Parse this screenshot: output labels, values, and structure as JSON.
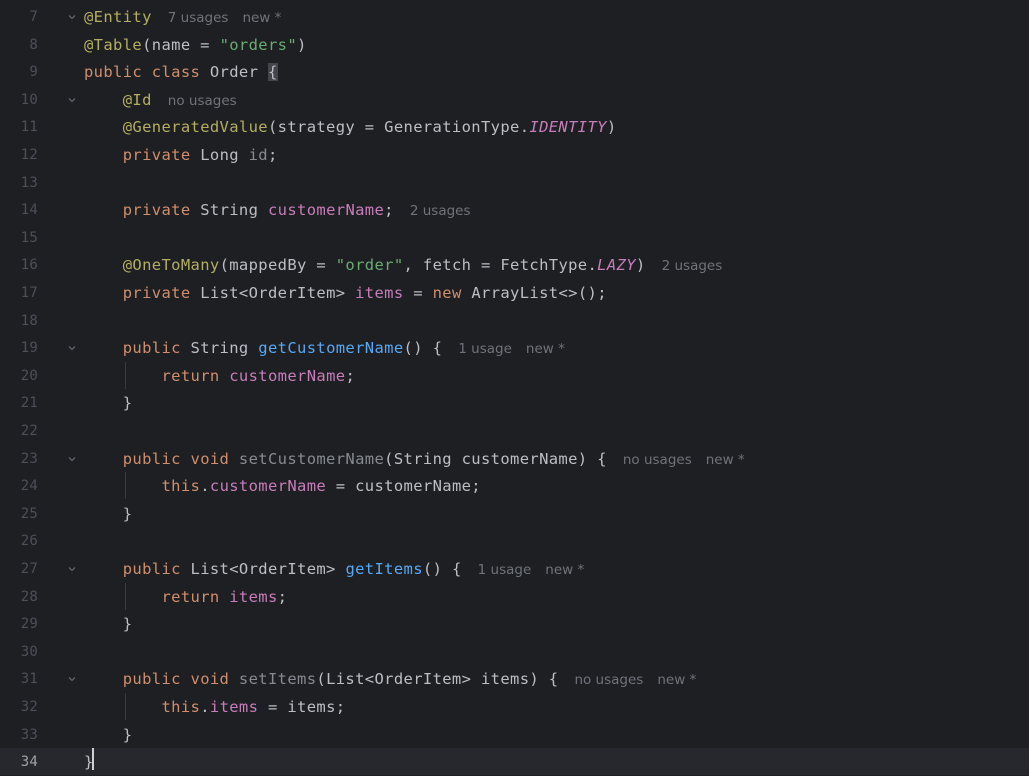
{
  "editor": {
    "language": "Java",
    "current_line": 34,
    "lines": [
      {
        "num": "7",
        "fold": true,
        "tokens": [
          [
            "ann",
            "@Entity"
          ]
        ],
        "hints": [
          "7 usages",
          "new *"
        ]
      },
      {
        "num": "8",
        "tokens": [
          [
            "ann",
            "@Table"
          ],
          [
            "plain",
            "(name = "
          ],
          [
            "str",
            "\"orders\""
          ],
          [
            "plain",
            ")"
          ]
        ]
      },
      {
        "num": "9",
        "tokens": [
          [
            "kw",
            "public class "
          ],
          [
            "plain",
            "Order "
          ],
          [
            "brace-hl",
            "{"
          ]
        ]
      },
      {
        "num": "10",
        "fold": true,
        "tokens": [
          [
            "plain",
            "    "
          ],
          [
            "ann",
            "@Id"
          ]
        ],
        "hints": [
          "no usages"
        ]
      },
      {
        "num": "11",
        "tokens": [
          [
            "plain",
            "    "
          ],
          [
            "ann",
            "@GeneratedValue"
          ],
          [
            "plain",
            "(strategy = GenerationType."
          ],
          [
            "static",
            "IDENTITY"
          ],
          [
            "plain",
            ")"
          ]
        ]
      },
      {
        "num": "12",
        "tokens": [
          [
            "plain",
            "    "
          ],
          [
            "kw",
            "private "
          ],
          [
            "plain",
            "Long "
          ],
          [
            "unused",
            "id"
          ],
          [
            "plain",
            ";"
          ]
        ]
      },
      {
        "num": "13",
        "tokens": []
      },
      {
        "num": "14",
        "tokens": [
          [
            "plain",
            "    "
          ],
          [
            "kw",
            "private "
          ],
          [
            "plain",
            "String "
          ],
          [
            "field",
            "customerName"
          ],
          [
            "plain",
            ";"
          ]
        ],
        "hints": [
          "2 usages"
        ]
      },
      {
        "num": "15",
        "tokens": []
      },
      {
        "num": "16",
        "tokens": [
          [
            "plain",
            "    "
          ],
          [
            "ann",
            "@OneToMany"
          ],
          [
            "plain",
            "(mappedBy = "
          ],
          [
            "str",
            "\"order\""
          ],
          [
            "plain",
            ", fetch = FetchType."
          ],
          [
            "static",
            "LAZY"
          ],
          [
            "plain",
            ")"
          ]
        ],
        "hints": [
          "2 usages"
        ]
      },
      {
        "num": "17",
        "tokens": [
          [
            "plain",
            "    "
          ],
          [
            "kw",
            "private "
          ],
          [
            "plain",
            "List<OrderItem> "
          ],
          [
            "field",
            "items"
          ],
          [
            "plain",
            " = "
          ],
          [
            "kw",
            "new "
          ],
          [
            "plain",
            "ArrayList<>();"
          ]
        ]
      },
      {
        "num": "18",
        "tokens": []
      },
      {
        "num": "19",
        "fold": true,
        "tokens": [
          [
            "plain",
            "    "
          ],
          [
            "kw",
            "public "
          ],
          [
            "plain",
            "String "
          ],
          [
            "fn",
            "getCustomerName"
          ],
          [
            "plain",
            "() {"
          ]
        ],
        "hints": [
          "1 usage",
          "new *"
        ]
      },
      {
        "num": "20",
        "guide": true,
        "tokens": [
          [
            "plain",
            "        "
          ],
          [
            "kw",
            "return "
          ],
          [
            "field",
            "customerName"
          ],
          [
            "plain",
            ";"
          ]
        ]
      },
      {
        "num": "21",
        "tokens": [
          [
            "plain",
            "    }"
          ]
        ]
      },
      {
        "num": "22",
        "tokens": []
      },
      {
        "num": "23",
        "fold": true,
        "tokens": [
          [
            "plain",
            "    "
          ],
          [
            "kw",
            "public void "
          ],
          [
            "unused",
            "setCustomerName"
          ],
          [
            "plain",
            "(String customerName) {"
          ]
        ],
        "hints": [
          "no usages",
          "new *"
        ]
      },
      {
        "num": "24",
        "guide": true,
        "tokens": [
          [
            "plain",
            "        "
          ],
          [
            "kw",
            "this"
          ],
          [
            "plain",
            "."
          ],
          [
            "field",
            "customerName"
          ],
          [
            "plain",
            " = customerName;"
          ]
        ]
      },
      {
        "num": "25",
        "tokens": [
          [
            "plain",
            "    }"
          ]
        ]
      },
      {
        "num": "26",
        "tokens": []
      },
      {
        "num": "27",
        "fold": true,
        "tokens": [
          [
            "plain",
            "    "
          ],
          [
            "kw",
            "public "
          ],
          [
            "plain",
            "List<OrderItem> "
          ],
          [
            "fn",
            "getItems"
          ],
          [
            "plain",
            "() {"
          ]
        ],
        "hints": [
          "1 usage",
          "new *"
        ]
      },
      {
        "num": "28",
        "guide": true,
        "tokens": [
          [
            "plain",
            "        "
          ],
          [
            "kw",
            "return "
          ],
          [
            "field",
            "items"
          ],
          [
            "plain",
            ";"
          ]
        ]
      },
      {
        "num": "29",
        "tokens": [
          [
            "plain",
            "    }"
          ]
        ]
      },
      {
        "num": "30",
        "tokens": []
      },
      {
        "num": "31",
        "fold": true,
        "tokens": [
          [
            "plain",
            "    "
          ],
          [
            "kw",
            "public void "
          ],
          [
            "unused",
            "setItems"
          ],
          [
            "plain",
            "(List<OrderItem> items) {"
          ]
        ],
        "hints": [
          "no usages",
          "new *"
        ]
      },
      {
        "num": "32",
        "guide": true,
        "tokens": [
          [
            "plain",
            "        "
          ],
          [
            "kw",
            "this"
          ],
          [
            "plain",
            "."
          ],
          [
            "field",
            "items"
          ],
          [
            "plain",
            " = items;"
          ]
        ]
      },
      {
        "num": "33",
        "tokens": [
          [
            "plain",
            "    }"
          ]
        ]
      },
      {
        "num": "34",
        "tokens": [
          [
            "plain",
            "}"
          ]
        ]
      }
    ]
  },
  "colors": {
    "background": "#1e1f22",
    "keyword": "#cf8e6d",
    "annotation": "#b3ae60",
    "string": "#6aab73",
    "field": "#c77dbb",
    "method": "#56a8f5",
    "unused": "#868a91",
    "hint": "#6f737a"
  },
  "icons": {
    "fold": "chevron-down-icon"
  }
}
